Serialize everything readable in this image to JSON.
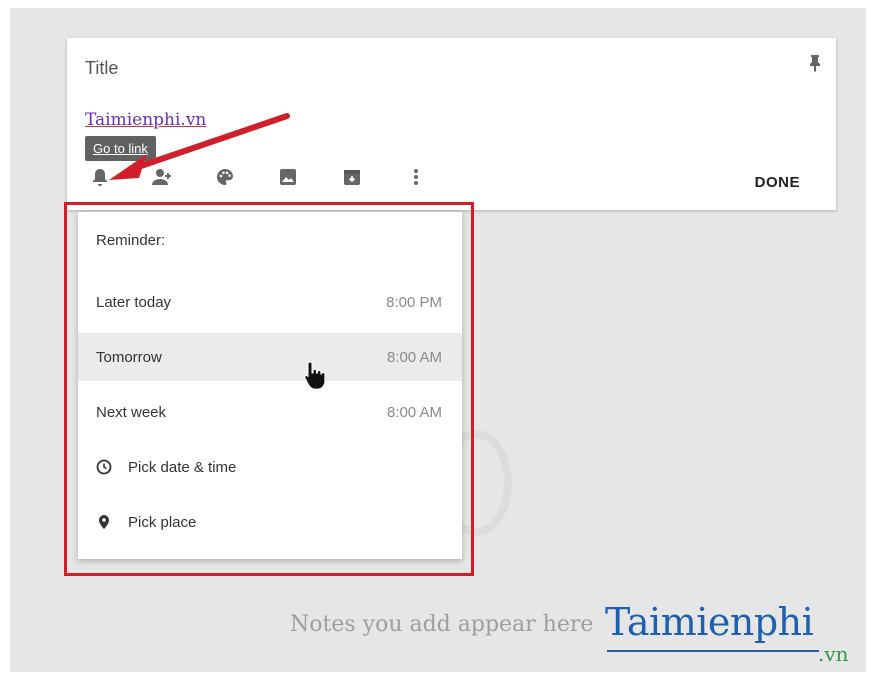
{
  "note": {
    "title": "Title",
    "link_text": "Taimienphi.vn",
    "tooltip": "Go to link",
    "done_label": "DONE",
    "toolbar_icons": [
      "reminder-bell-icon",
      "collaborator-icon",
      "palette-icon",
      "image-icon",
      "archive-icon",
      "more-vert-icon"
    ]
  },
  "reminder": {
    "header": "Reminder:",
    "items": [
      {
        "label": "Later today",
        "time": "8:00 PM"
      },
      {
        "label": "Tomorrow",
        "time": "8:00 AM"
      },
      {
        "label": "Next week",
        "time": "8:00 AM"
      }
    ],
    "pick_date_label": "Pick date & time",
    "pick_place_label": "Pick place"
  },
  "empty_state": "Notes you add appear here",
  "watermark": {
    "brand": "Taimienphi",
    "tld": ".vn"
  },
  "colors": {
    "annotation_red": "#d01f2b",
    "link_purple": "#6b2fb3",
    "brand_blue": "#1f5fb0",
    "brand_green": "#2d9e3b"
  }
}
